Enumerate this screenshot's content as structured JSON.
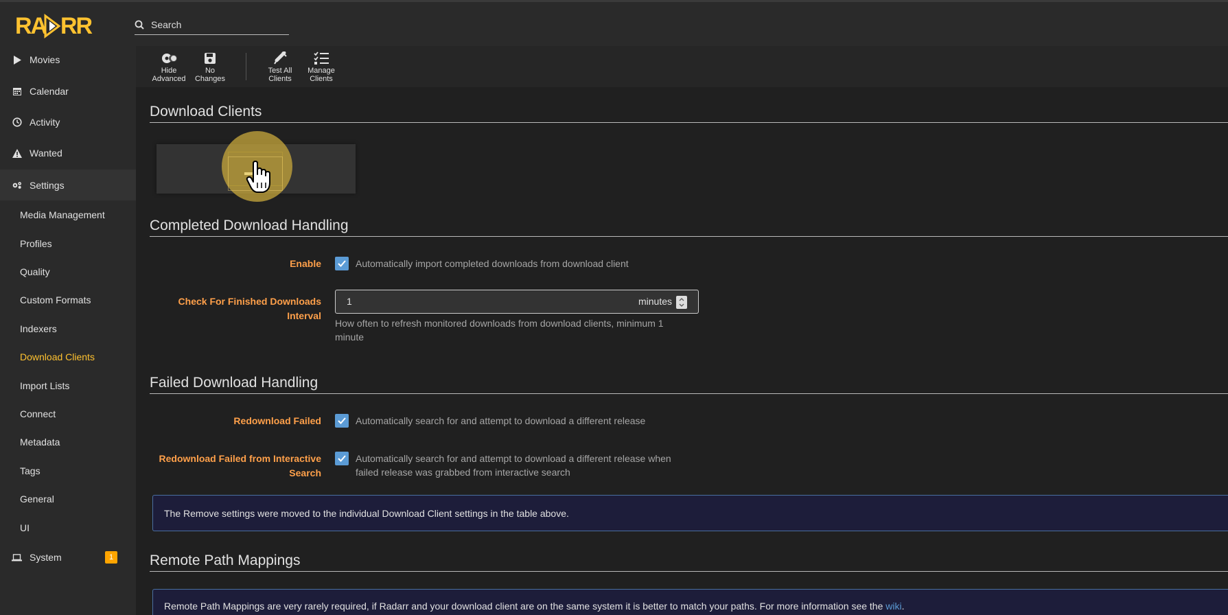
{
  "app": {
    "logo_text": "RADARR"
  },
  "search": {
    "placeholder": "Search"
  },
  "sidebar": {
    "items": [
      {
        "label": "Movies"
      },
      {
        "label": "Calendar"
      },
      {
        "label": "Activity"
      },
      {
        "label": "Wanted"
      },
      {
        "label": "Settings"
      },
      {
        "label": "System",
        "badge": "1"
      }
    ],
    "settings_sub": [
      {
        "label": "Media Management"
      },
      {
        "label": "Profiles"
      },
      {
        "label": "Quality"
      },
      {
        "label": "Custom Formats"
      },
      {
        "label": "Indexers"
      },
      {
        "label": "Download Clients"
      },
      {
        "label": "Import Lists"
      },
      {
        "label": "Connect"
      },
      {
        "label": "Metadata"
      },
      {
        "label": "Tags"
      },
      {
        "label": "General"
      },
      {
        "label": "UI"
      }
    ]
  },
  "toolbar": {
    "hide_advanced": [
      "Hide",
      "Advanced"
    ],
    "no_changes": [
      "No",
      "Changes"
    ],
    "test_all": [
      "Test All",
      "Clients"
    ],
    "manage": [
      "Manage",
      "Clients"
    ]
  },
  "sections": {
    "download_clients": "Download Clients",
    "completed": "Completed Download Handling",
    "failed": "Failed Download Handling",
    "remote": "Remote Path Mappings"
  },
  "completed": {
    "enable_label": "Enable",
    "enable_text": "Automatically import completed downloads from download client",
    "interval_label_1": "Check For Finished Downloads",
    "interval_label_2": "Interval",
    "interval_value": "1",
    "interval_unit": "minutes",
    "interval_help_1": "How often to refresh monitored downloads from download clients, minimum 1",
    "interval_help_2": "minute"
  },
  "failed": {
    "redownload_label": "Redownload Failed",
    "redownload_text": "Automatically search for and attempt to download a different release",
    "interactive_label_1": "Redownload Failed from Interactive",
    "interactive_label_2": "Search",
    "interactive_text_1": "Automatically search for and attempt to download a different release when",
    "interactive_text_2": "failed release was grabbed from interactive search",
    "remove_notice": "The Remove settings were moved to the individual Download Client settings in the table above."
  },
  "remote": {
    "notice_text": "Remote Path Mappings are very rarely required, if Radarr and your download client are on the same system it is better to match your paths. For more information see the ",
    "link_text": "wiki",
    "notice_end": "."
  },
  "colors": {
    "accent": "#ffc230",
    "label": "#ffa04a",
    "checkbox": "#5b9bd5",
    "badge": "#ffa500"
  }
}
